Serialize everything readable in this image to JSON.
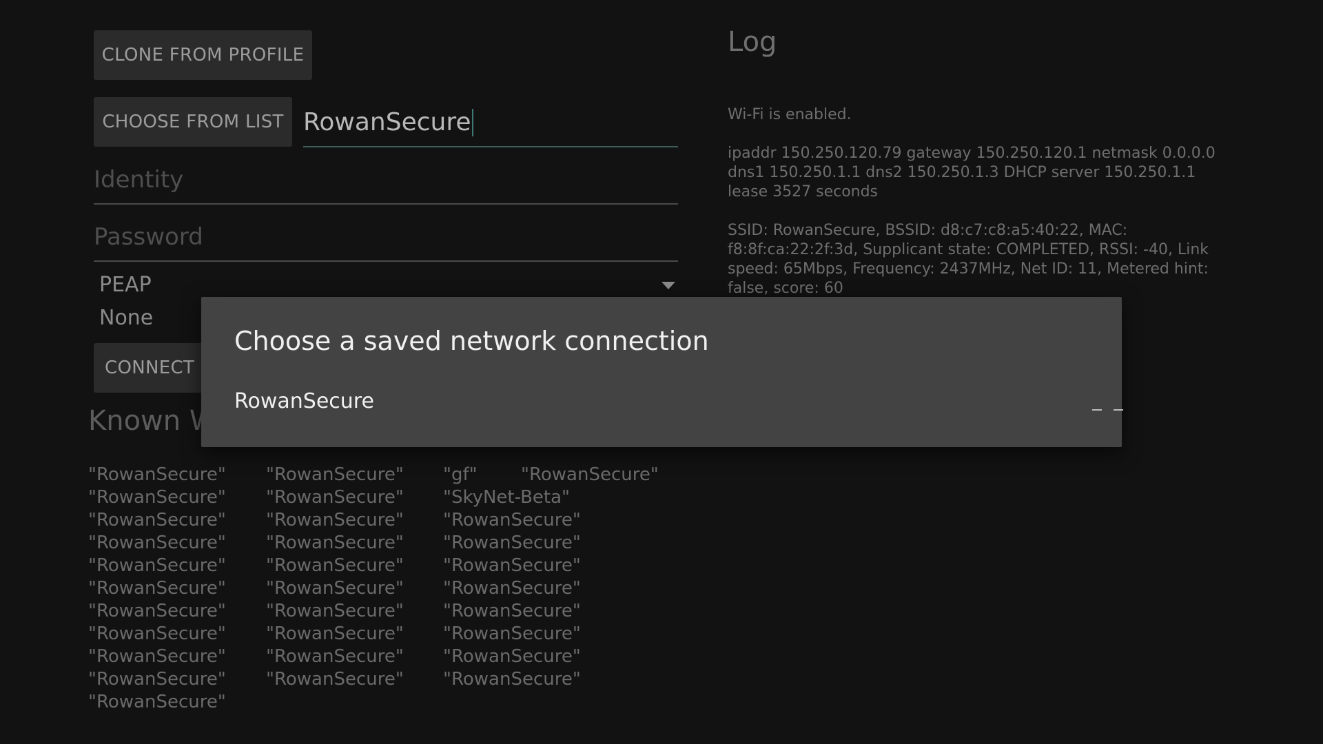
{
  "buttons": {
    "clone_from_profile": "CLONE FROM PROFILE",
    "choose_from_list": "CHOOSE FROM LIST",
    "connect": "CONNECT"
  },
  "form": {
    "ssid_value": "RowanSecure",
    "identity_placeholder": "Identity",
    "password_placeholder": "Password",
    "eap_method": "PEAP",
    "phase2": "None"
  },
  "log": {
    "title": "Log",
    "entries": [
      "Wi-Fi is enabled.",
      "ipaddr 150.250.120.79 gateway 150.250.120.1 netmask 0.0.0.0 dns1 150.250.1.1 dns2 150.250.1.3 DHCP server 150.250.1.1 lease 3527 seconds",
      "SSID: RowanSecure, BSSID: d8:c7:c8:a5:40:22, MAC: f8:8f:ca:22:2f:3d, Supplicant state: COMPLETED, RSSI: -40, Link speed: 65Mbps, Frequency: 2437MHz, Net ID: 11, Metered hint: false, score: 60"
    ]
  },
  "known": {
    "title": "Known W",
    "columns": [
      [
        "\"RowanSecure\"",
        "\"RowanSecure\"",
        "\"RowanSecure\"",
        "\"RowanSecure\"",
        "\"RowanSecure\"",
        "\"RowanSecure\"",
        "\"RowanSecure\"",
        "\"RowanSecure\"",
        "\"RowanSecure\"",
        "\"RowanSecure\"",
        "\"RowanSecure\""
      ],
      [
        "\"RowanSecure\"",
        "\"RowanSecure\"",
        "\"RowanSecure\"",
        "\"RowanSecure\"",
        "\"RowanSecure\"",
        "\"RowanSecure\"",
        "\"RowanSecure\"",
        "\"RowanSecure\"",
        "\"RowanSecure\"",
        "\"RowanSecure\""
      ],
      [
        "\"gf\"",
        "\"SkyNet-Beta\"",
        "\"RowanSecure\"",
        "\"RowanSecure\"",
        "\"RowanSecure\"",
        "\"RowanSecure\"",
        "\"RowanSecure\"",
        "\"RowanSecure\"",
        "\"RowanSecure\"",
        "\"RowanSecure\""
      ],
      [
        "\"RowanSecure\""
      ]
    ]
  },
  "dialog": {
    "title": "Choose a saved network connection",
    "items": [
      "RowanSecure"
    ]
  },
  "colors": {
    "background": "#121212",
    "dialog_background": "#434343",
    "accent_underline": "#3e5c58"
  }
}
